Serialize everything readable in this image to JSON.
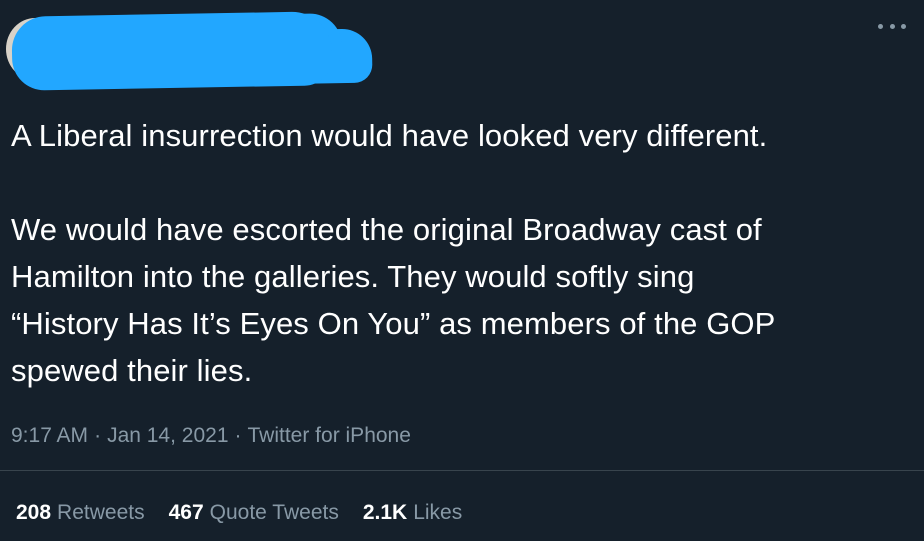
{
  "tweet": {
    "text_lines": [
      "A Liberal insurrection would have looked very different.",
      "",
      "We would have escorted the original Broadway cast of",
      "Hamilton into the galleries. They would softly sing",
      "“History Has It’s Eyes On You” as members of the GOP",
      "spewed their lies."
    ],
    "timestamp": "9:17 AM",
    "date": "Jan 14, 2021",
    "source": "Twitter for iPhone",
    "stats": {
      "retweets_count": "208",
      "retweets_label": "Retweets",
      "quote_count": "467",
      "quote_label": "Quote Tweets",
      "likes_count": "2.1K",
      "likes_label": "Likes"
    }
  },
  "colors": {
    "background": "#15202b",
    "text": "#ffffff",
    "secondary_text": "#8899a6",
    "redaction": "#22a7ff",
    "divider": "#38444d"
  },
  "icons": {
    "more": "more-icon"
  }
}
